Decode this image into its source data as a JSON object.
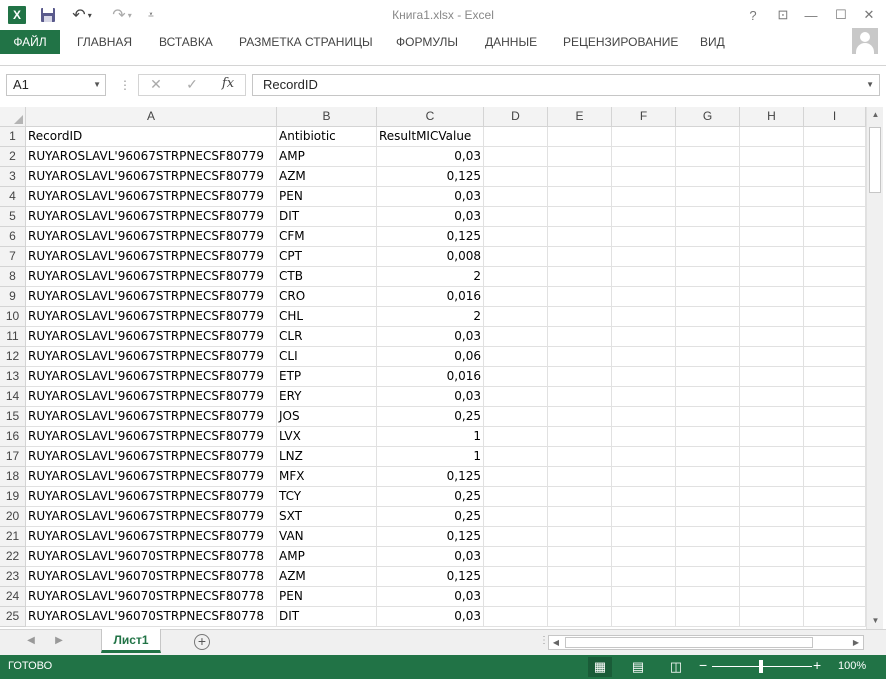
{
  "app": {
    "title": "Книга1.xlsx - Excel",
    "logo_text": "X"
  },
  "window_controls": {
    "help": "?",
    "ribbon_options": "⊡",
    "minimize": "—",
    "maximize": "☐",
    "close": "✕"
  },
  "ribbon": {
    "tabs": [
      {
        "label": "ФАЙЛ"
      },
      {
        "label": "ГЛАВНАЯ"
      },
      {
        "label": "ВСТАВКА"
      },
      {
        "label": "РАЗМЕТКА СТРАНИЦЫ"
      },
      {
        "label": "ФОРМУЛЫ"
      },
      {
        "label": "ДАННЫЕ"
      },
      {
        "label": "РЕЦЕНЗИРОВАНИЕ"
      },
      {
        "label": "ВИД"
      }
    ]
  },
  "formula_bar": {
    "name_box": "A1",
    "content": "RecordID",
    "fx_label": "fx"
  },
  "columns": [
    "A",
    "B",
    "C",
    "D",
    "E",
    "F",
    "G",
    "H",
    "I"
  ],
  "rows": [
    {
      "num": "1",
      "a": "RecordID",
      "b": "Antibiotic",
      "c": "ResultMICValue"
    },
    {
      "num": "2",
      "a": "RUYAROSLAVL'96067STRPNECSF80779",
      "b": "AMP",
      "c": "0,03"
    },
    {
      "num": "3",
      "a": "RUYAROSLAVL'96067STRPNECSF80779",
      "b": "AZM",
      "c": "0,125"
    },
    {
      "num": "4",
      "a": "RUYAROSLAVL'96067STRPNECSF80779",
      "b": "PEN",
      "c": "0,03"
    },
    {
      "num": "5",
      "a": "RUYAROSLAVL'96067STRPNECSF80779",
      "b": "DIT",
      "c": "0,03"
    },
    {
      "num": "6",
      "a": "RUYAROSLAVL'96067STRPNECSF80779",
      "b": "CFM",
      "c": "0,125"
    },
    {
      "num": "7",
      "a": "RUYAROSLAVL'96067STRPNECSF80779",
      "b": "CPT",
      "c": "0,008"
    },
    {
      "num": "8",
      "a": "RUYAROSLAVL'96067STRPNECSF80779",
      "b": "CTB",
      "c": "2"
    },
    {
      "num": "9",
      "a": "RUYAROSLAVL'96067STRPNECSF80779",
      "b": "CRO",
      "c": "0,016"
    },
    {
      "num": "10",
      "a": "RUYAROSLAVL'96067STRPNECSF80779",
      "b": "CHL",
      "c": "2"
    },
    {
      "num": "11",
      "a": "RUYAROSLAVL'96067STRPNECSF80779",
      "b": "CLR",
      "c": "0,03"
    },
    {
      "num": "12",
      "a": "RUYAROSLAVL'96067STRPNECSF80779",
      "b": "CLI",
      "c": "0,06"
    },
    {
      "num": "13",
      "a": "RUYAROSLAVL'96067STRPNECSF80779",
      "b": "ETP",
      "c": "0,016"
    },
    {
      "num": "14",
      "a": "RUYAROSLAVL'96067STRPNECSF80779",
      "b": "ERY",
      "c": "0,03"
    },
    {
      "num": "15",
      "a": "RUYAROSLAVL'96067STRPNECSF80779",
      "b": "JOS",
      "c": "0,25"
    },
    {
      "num": "16",
      "a": "RUYAROSLAVL'96067STRPNECSF80779",
      "b": "LVX",
      "c": "1"
    },
    {
      "num": "17",
      "a": "RUYAROSLAVL'96067STRPNECSF80779",
      "b": "LNZ",
      "c": "1"
    },
    {
      "num": "18",
      "a": "RUYAROSLAVL'96067STRPNECSF80779",
      "b": "MFX",
      "c": "0,125"
    },
    {
      "num": "19",
      "a": "RUYAROSLAVL'96067STRPNECSF80779",
      "b": "TCY",
      "c": "0,25"
    },
    {
      "num": "20",
      "a": "RUYAROSLAVL'96067STRPNECSF80779",
      "b": "SXT",
      "c": "0,25"
    },
    {
      "num": "21",
      "a": "RUYAROSLAVL'96067STRPNECSF80779",
      "b": "VAN",
      "c": "0,125"
    },
    {
      "num": "22",
      "a": "RUYAROSLAVL'96070STRPNECSF80778",
      "b": "AMP",
      "c": "0,03"
    },
    {
      "num": "23",
      "a": "RUYAROSLAVL'96070STRPNECSF80778",
      "b": "AZM",
      "c": "0,125"
    },
    {
      "num": "24",
      "a": "RUYAROSLAVL'96070STRPNECSF80778",
      "b": "PEN",
      "c": "0,03"
    },
    {
      "num": "25",
      "a": "RUYAROSLAVL'96070STRPNECSF80778",
      "b": "DIT",
      "c": "0,03"
    }
  ],
  "sheet_tabs": [
    {
      "label": "Лист1",
      "active": true
    }
  ],
  "status": {
    "text": "ГОТОВО",
    "zoom": "100%",
    "zoom_minus": "−",
    "zoom_plus": "+",
    "zoom_level": 0.5
  },
  "colors": {
    "accent": "#217346",
    "grid_line": "#e1e1e1",
    "header_bg": "#f3f3f3"
  }
}
